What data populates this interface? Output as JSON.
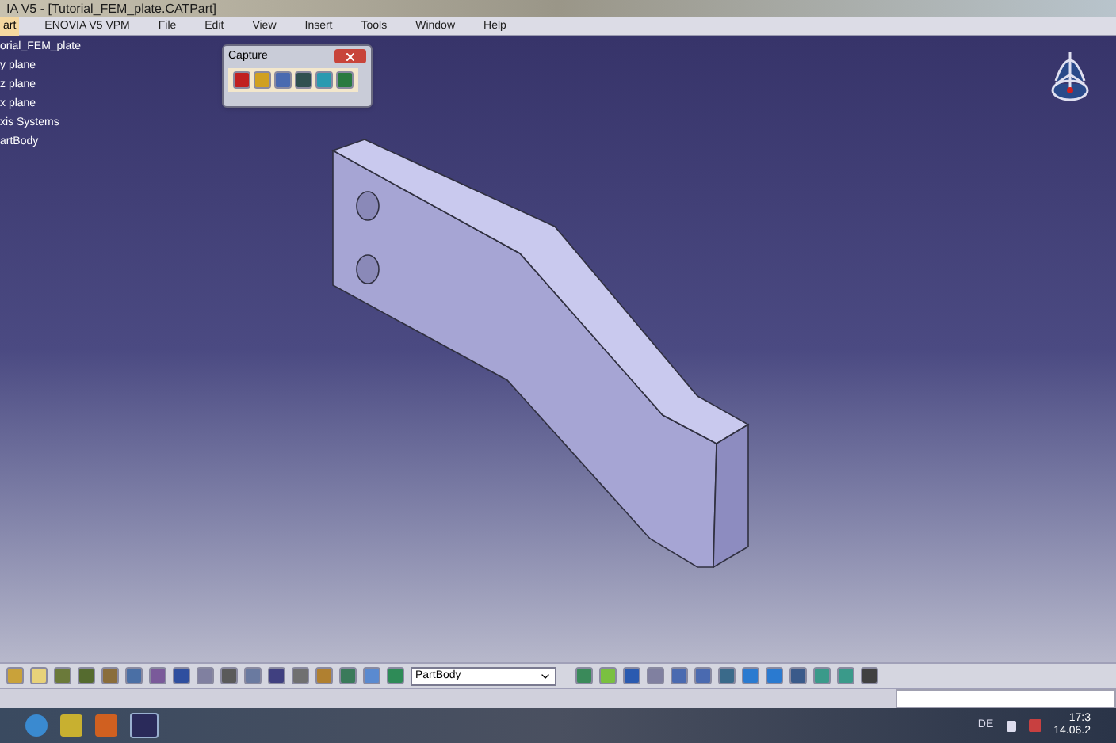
{
  "window": {
    "title": "IA V5 - [Tutorial_FEM_plate.CATPart]"
  },
  "menu": [
    {
      "label": "art",
      "selected": true
    },
    {
      "label": "ENOVIA V5 VPM",
      "selected": false
    },
    {
      "label": "File",
      "selected": false
    },
    {
      "label": "Edit",
      "selected": false
    },
    {
      "label": "View",
      "selected": false
    },
    {
      "label": "Insert",
      "selected": false
    },
    {
      "label": "Tools",
      "selected": false
    },
    {
      "label": "Window",
      "selected": false
    },
    {
      "label": "Help",
      "selected": false
    }
  ],
  "tree": {
    "items": [
      "orial_FEM_plate",
      "y plane",
      "z plane",
      "x plane",
      "xis Systems",
      "artBody"
    ]
  },
  "capture_toolbar": {
    "title": "Capture"
  },
  "toolbar": {
    "dropdown": {
      "value": "PartBody"
    }
  },
  "taskbar": {
    "language": "DE",
    "time": "17:3",
    "date": "14.06.2"
  }
}
